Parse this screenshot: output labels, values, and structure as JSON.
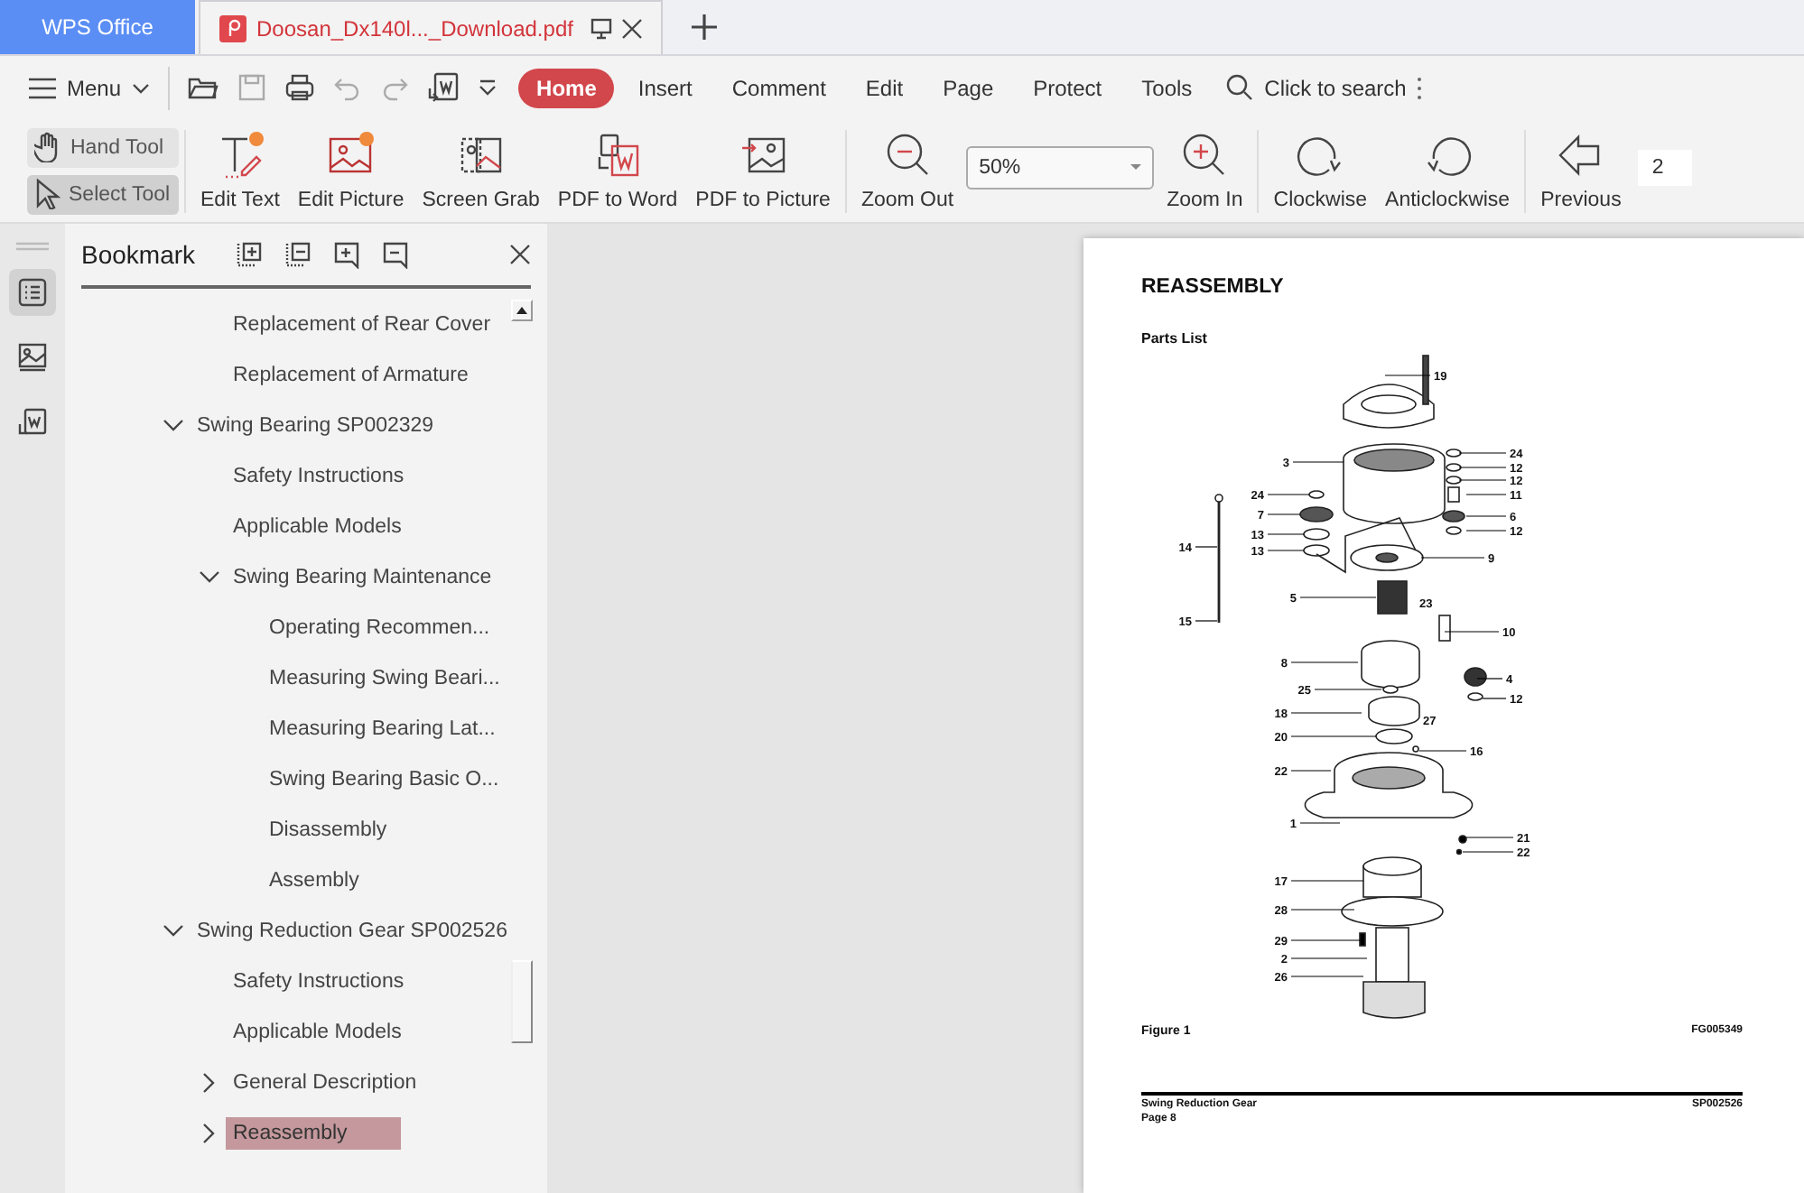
{
  "window_tabs": [
    {
      "kind": "app",
      "label": "WPS Office",
      "selected": false
    },
    {
      "kind": "document",
      "label": "Doosan_Dx140l..._Download.pdf",
      "selected": true
    }
  ],
  "menu": {
    "label": "Menu"
  },
  "ribbon_tabs": [
    {
      "label": "Home",
      "selected": true
    },
    {
      "label": "Insert",
      "selected": false
    },
    {
      "label": "Comment",
      "selected": false
    },
    {
      "label": "Edit",
      "selected": false
    },
    {
      "label": "Page",
      "selected": false
    },
    {
      "label": "Protect",
      "selected": false
    },
    {
      "label": "Tools",
      "selected": false
    }
  ],
  "search": {
    "placeholder": "Click to search"
  },
  "tools": [
    {
      "label": "Hand Tool",
      "selected": false
    },
    {
      "label": "Select Tool",
      "selected": true
    }
  ],
  "toolbar_groups": [
    [
      {
        "kind": "button",
        "label": "Edit Text"
      },
      {
        "kind": "button",
        "label": "Edit Picture"
      },
      {
        "kind": "button",
        "label": "Screen Grab"
      },
      {
        "kind": "button",
        "label": "PDF to Word"
      },
      {
        "kind": "button",
        "label": "PDF to Picture"
      }
    ],
    [
      {
        "kind": "button",
        "label": "Zoom Out"
      },
      {
        "kind": "zoom",
        "value": "50%"
      },
      {
        "kind": "button",
        "label": "Zoom In"
      }
    ],
    [
      {
        "kind": "button",
        "label": "Clockwise"
      },
      {
        "kind": "button",
        "label": "Anticlockwise"
      }
    ],
    [
      {
        "kind": "button",
        "label": "Previous"
      },
      {
        "kind": "page",
        "value": "2"
      }
    ]
  ],
  "rail": [
    {
      "selected": true
    },
    {
      "selected": false
    },
    {
      "selected": false
    }
  ],
  "bookmark_panel": {
    "title": "Bookmark",
    "items": [
      {
        "children": [
          {
            "label": "Replacement of Rear Cover",
            "selected": false
          },
          {
            "label": "Replacement of Armature",
            "selected": false
          }
        ]
      },
      {
        "label": "Swing Bearing SP002329",
        "selected": false,
        "expanded": true,
        "children": [
          {
            "label": "Safety Instructions",
            "selected": false
          },
          {
            "label": "Applicable Models",
            "selected": false
          },
          {
            "label": "Swing Bearing Maintenance",
            "selected": false,
            "expanded": true,
            "children": [
              {
                "label": "Operating Recommen...",
                "selected": false
              },
              {
                "label": "Measuring Swing Beari...",
                "selected": false
              },
              {
                "label": "Measuring Bearing Lat...",
                "selected": false
              },
              {
                "label": "Swing Bearing Basic O...",
                "selected": false
              },
              {
                "label": "Disassembly",
                "selected": false
              },
              {
                "label": "Assembly",
                "selected": false
              }
            ]
          }
        ]
      },
      {
        "label": "Swing Reduction Gear SP002526",
        "selected": false,
        "expanded": true,
        "children": [
          {
            "label": "Safety Instructions",
            "selected": false
          },
          {
            "label": "Applicable Models",
            "selected": false
          },
          {
            "label": "General Description",
            "selected": false,
            "expanded": false
          },
          {
            "label": "Reassembly",
            "selected": true,
            "expanded": false
          }
        ]
      }
    ]
  },
  "pdf_page": {
    "heading": "REASSEMBLY",
    "subheading": "Parts List",
    "callouts": [
      "19",
      "3",
      "24",
      "12",
      "12",
      "24",
      "11",
      "7",
      "6",
      "12",
      "13",
      "14",
      "13",
      "9",
      "23",
      "5",
      "15",
      "10",
      "8",
      "4",
      "25",
      "12",
      "18",
      "27",
      "20",
      "16",
      "22",
      "1",
      "21",
      "22",
      "17",
      "28",
      "29",
      "2",
      "26"
    ],
    "figure_caption": "Figure 1",
    "figure_code": "FG005349",
    "footer": {
      "title": "Swing Reduction Gear",
      "page": "Page 8",
      "code": "SP002526"
    }
  }
}
